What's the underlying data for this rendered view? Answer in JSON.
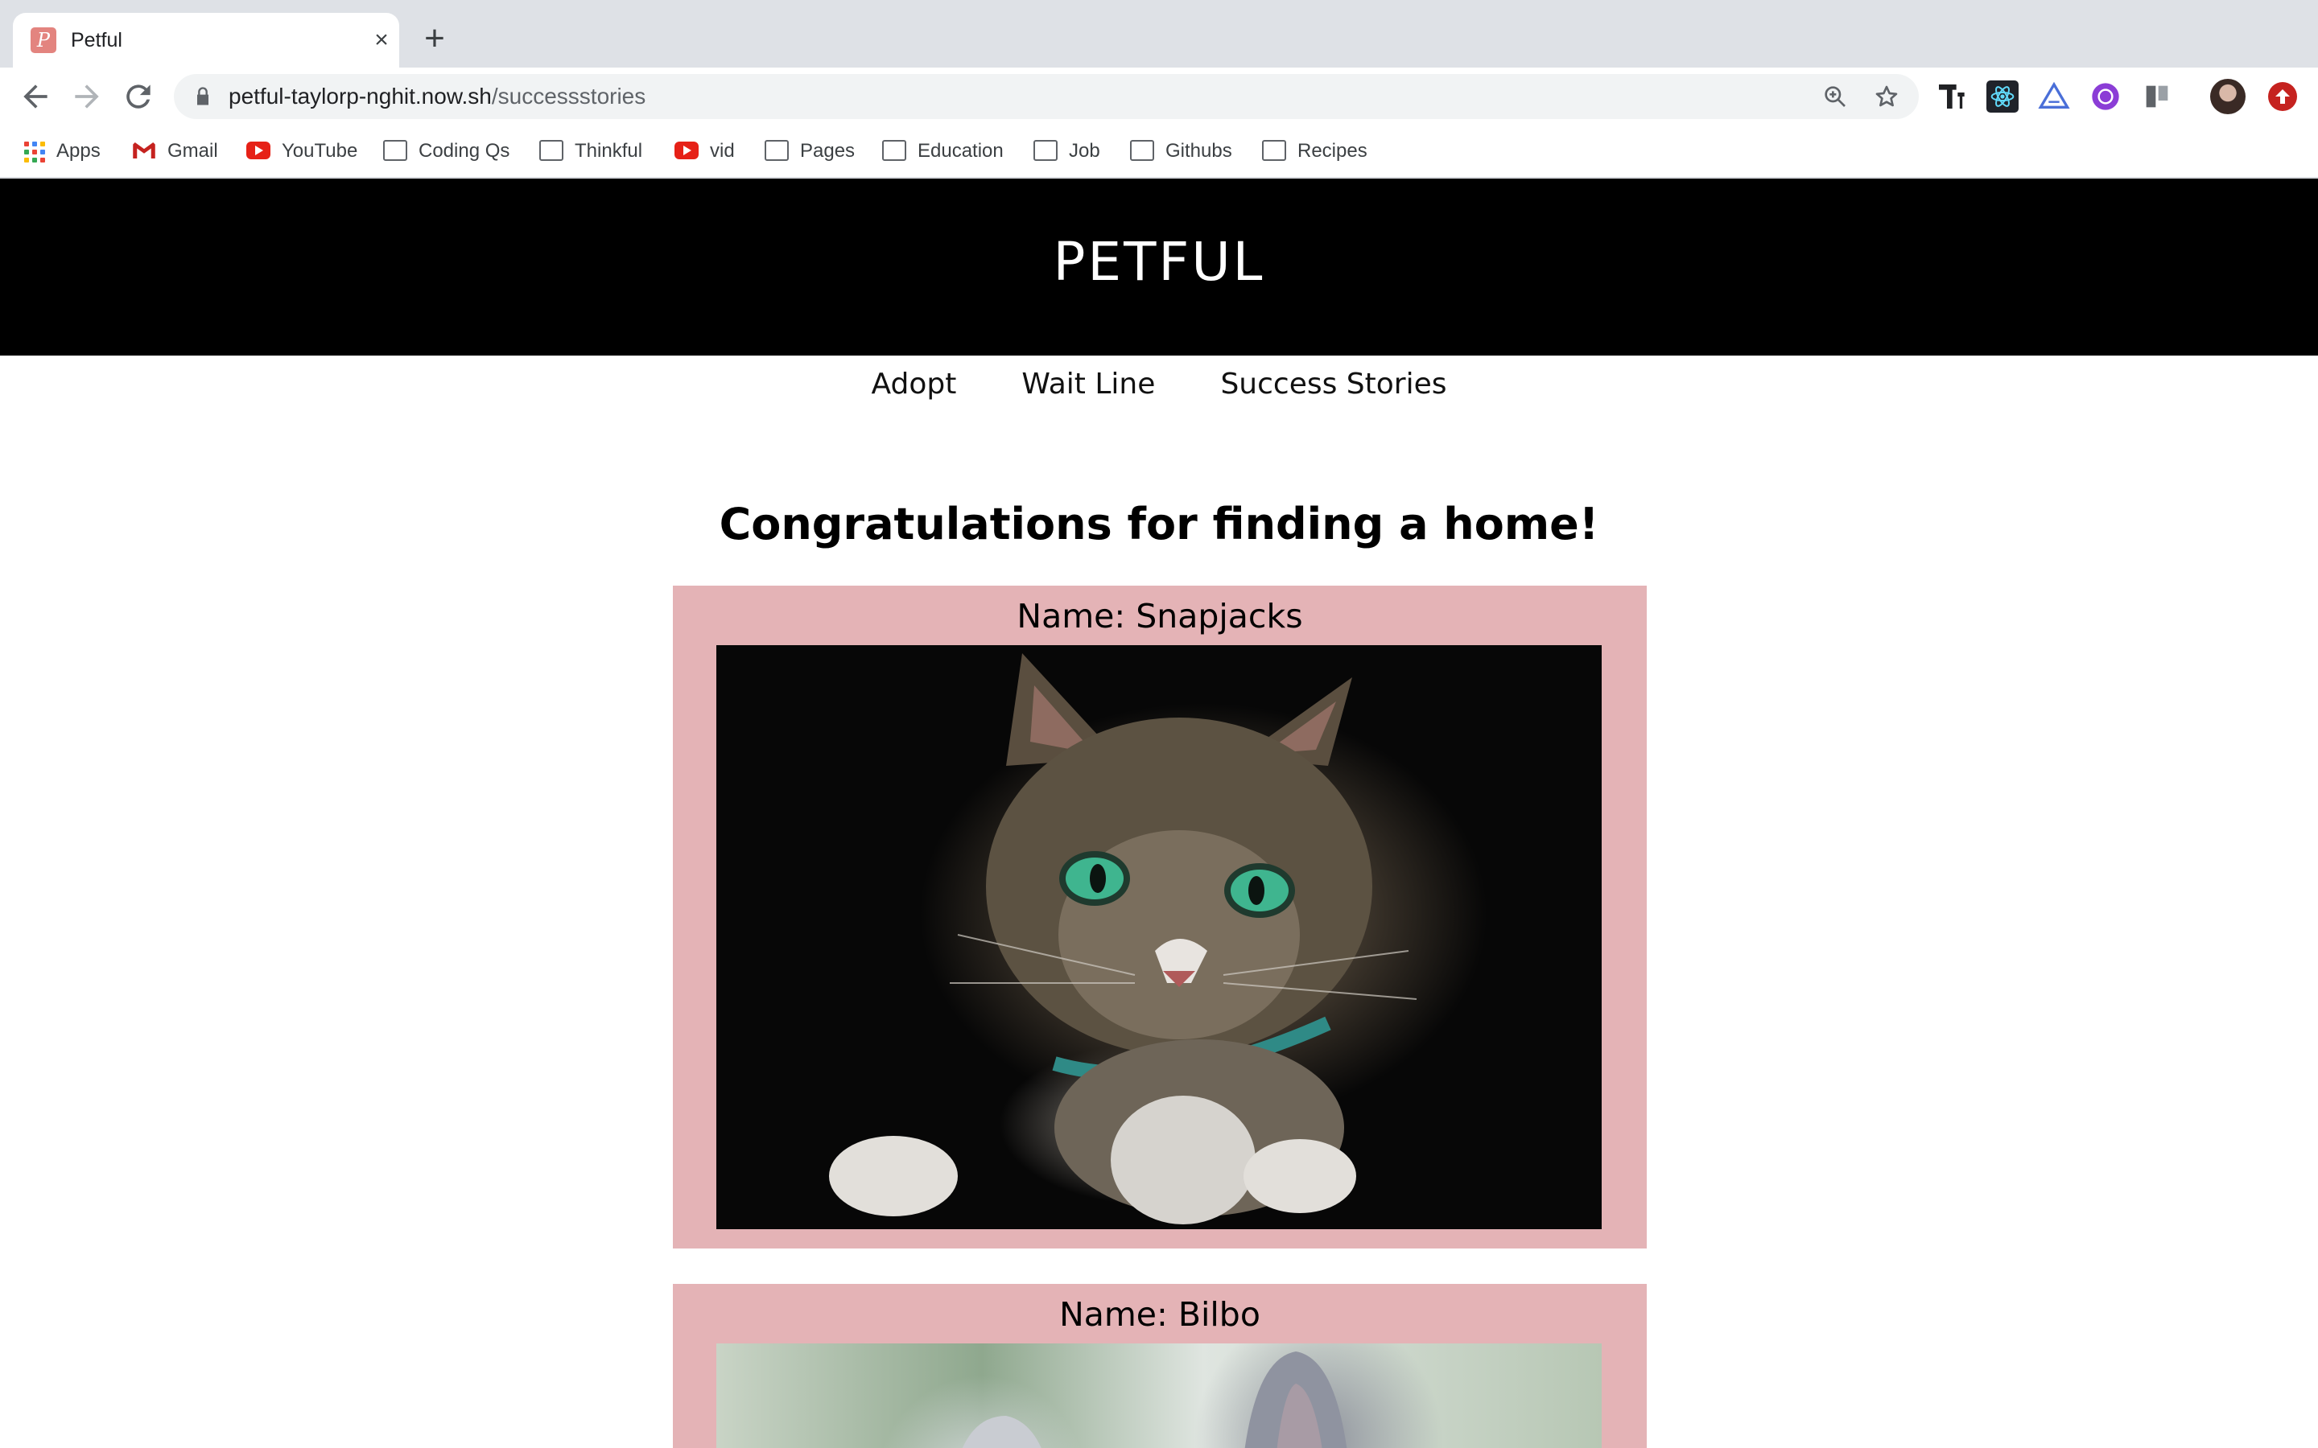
{
  "browser": {
    "tab_title": "Petful",
    "url_host": "petful-taylorp-nghit.now.sh",
    "url_path": "/successstories",
    "bookmarks": [
      {
        "label": "Apps",
        "icon": "apps-grid-icon"
      },
      {
        "label": "Gmail",
        "icon": "gmail-icon"
      },
      {
        "label": "YouTube",
        "icon": "youtube-icon"
      },
      {
        "label": "Coding Qs",
        "icon": "folder-icon"
      },
      {
        "label": "Thinkful",
        "icon": "folder-icon"
      },
      {
        "label": "vid",
        "icon": "youtube-icon"
      },
      {
        "label": "Pages",
        "icon": "folder-icon"
      },
      {
        "label": "Education",
        "icon": "folder-icon"
      },
      {
        "label": "Job",
        "icon": "folder-icon"
      },
      {
        "label": "Githubs",
        "icon": "folder-icon"
      },
      {
        "label": "Recipes",
        "icon": "folder-icon"
      }
    ]
  },
  "site": {
    "title": "PETFUL",
    "nav": [
      "Adopt",
      "Wait Line",
      "Success Stories"
    ],
    "heading": "Congratulations for finding a home!",
    "stories": [
      {
        "name": "Name: Snapjacks",
        "photo": "tabby cat with green eyes and teal collar"
      },
      {
        "name": "Name: Bilbo",
        "photo": "dog with tall ears outdoors"
      }
    ]
  },
  "colors": {
    "header_bg": "#000000",
    "card_bg": "#e4b3b6",
    "tabstrip_bg": "#dee1e6"
  }
}
